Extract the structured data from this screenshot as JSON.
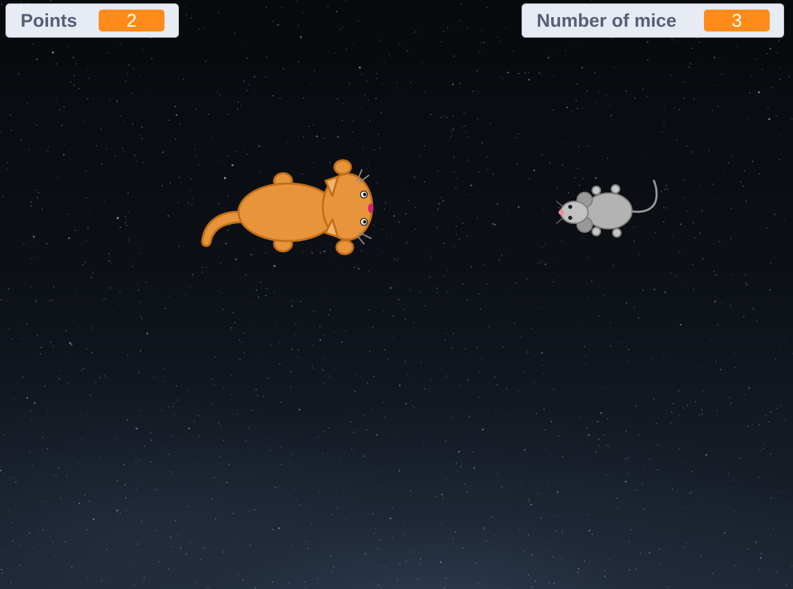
{
  "monitors": {
    "points": {
      "label": "Points",
      "value": "2"
    },
    "mice": {
      "label": "Number of mice",
      "value": "3"
    }
  },
  "colors": {
    "monitor_bg": "#e6ebf4",
    "monitor_value_bg": "#ff8c1a",
    "monitor_label_text": "#575e75",
    "cat_body": "#e8943a",
    "mouse_body": "#b3b3b3"
  },
  "sprites": [
    {
      "name": "cat",
      "icon": "cat-sprite",
      "facing": "right"
    },
    {
      "name": "mouse",
      "icon": "mouse-sprite",
      "facing": "left"
    }
  ],
  "backdrop": "starry-night-sky"
}
